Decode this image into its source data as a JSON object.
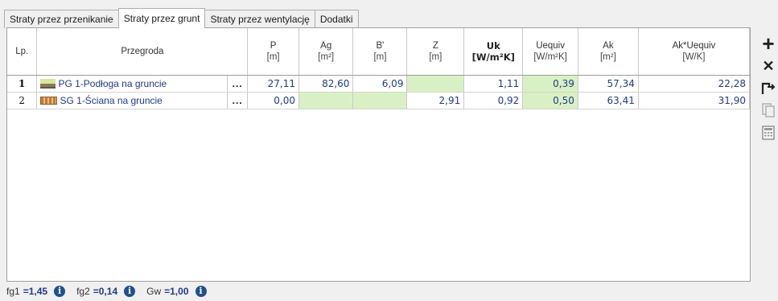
{
  "tabs": [
    {
      "label": "Straty przez przenikanie"
    },
    {
      "label": "Straty przez grunt"
    },
    {
      "label": "Straty przez wentylację"
    },
    {
      "label": "Dodatki"
    }
  ],
  "table": {
    "headers": {
      "lp": "Lp.",
      "przegroda": "Przegroda",
      "p": "P",
      "p_unit": "[m]",
      "ag": "Ag",
      "ag_unit": "[m²]",
      "b": "B'",
      "b_unit": "[m]",
      "z": "Z",
      "z_unit": "[m]",
      "uk": "Uk",
      "uk_unit": "[W/m²K]",
      "uequiv": "Uequiv",
      "uequiv_unit": "[W/m²K]",
      "ak": "Ak",
      "ak_unit": "[m²]",
      "akuequiv": "Ak*Uequiv",
      "akuequiv_unit": "[W/K]"
    },
    "rows": [
      {
        "lp": "1",
        "icon": "floor-on-ground-icon",
        "name": "PG 1-Podłoga na gruncie",
        "dots": "...",
        "p": "27,11",
        "ag": "82,60",
        "b": "6,09",
        "z": "",
        "uk": "1,11",
        "uequiv": "0,39",
        "ak": "57,34",
        "akuequiv": "22,28"
      },
      {
        "lp": "2",
        "icon": "wall-on-ground-icon",
        "name": "SG 1-Ściana na gruncie",
        "dots": "...",
        "p": "0,00",
        "ag": "",
        "b": "",
        "z": "2,91",
        "uk": "0,92",
        "uequiv": "0,50",
        "ak": "63,41",
        "akuequiv": "31,90"
      }
    ]
  },
  "sidebar": {
    "add": "+",
    "delete": "✕"
  },
  "footer": {
    "fg1_label": "fg1",
    "fg1_value": "=1,45",
    "fg2_label": "fg2",
    "fg2_value": "=0,14",
    "gw_label": "Gw",
    "gw_value": "=1,00",
    "info": "i"
  },
  "colors": {
    "green_cell": "#d9f0c4",
    "value_text": "#1f3b86",
    "info_icon": "#1e4f8f"
  }
}
